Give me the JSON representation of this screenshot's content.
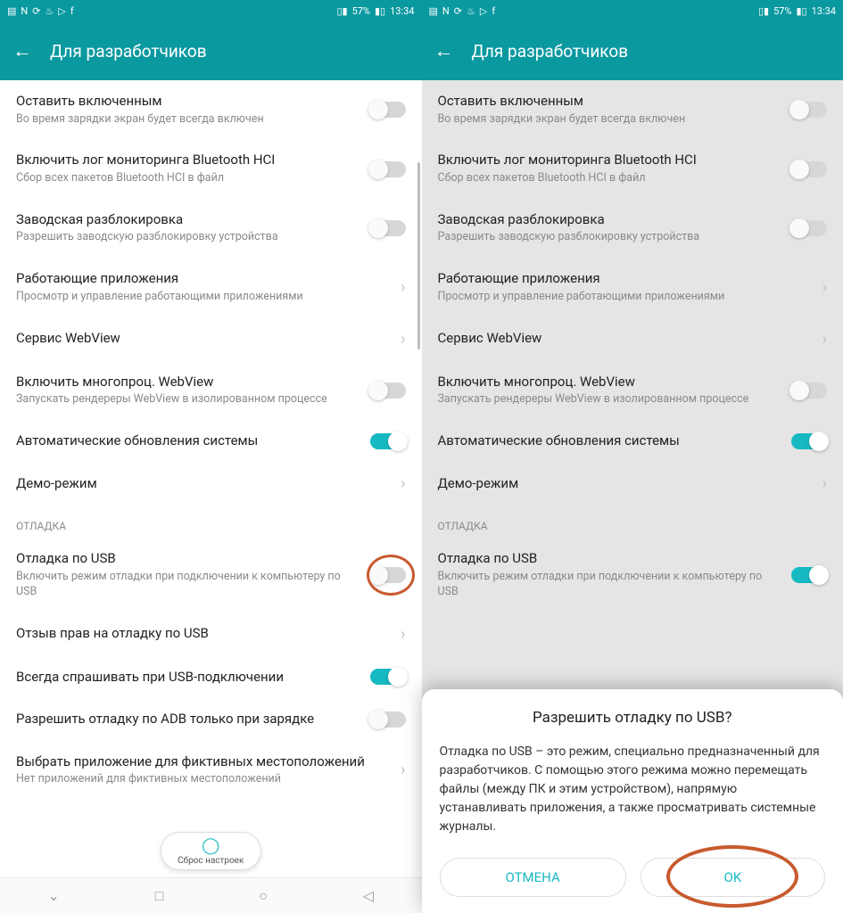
{
  "status_bar": {
    "icons_left": [
      "notif-icon",
      "nfc-icon",
      "sync-icon",
      "usb-icon",
      "play-icon",
      "facebook-icon"
    ],
    "vibrate_icon": "▮▯",
    "battery_pct": "57%",
    "battery_icon": "▮▯▯",
    "time": "13:34"
  },
  "app_bar": {
    "title": "Для разработчиков"
  },
  "sections": [
    {
      "header": null,
      "items": [
        {
          "id": "stay-awake",
          "title": "Оставить включенным",
          "sub": "Во время зарядки экран будет всегда включен",
          "ctrl": "toggle",
          "state": "off"
        },
        {
          "id": "bt-hci-log",
          "title": "Включить лог мониторинга Bluetooth HCI",
          "sub": "Сбор всех пакетов Bluetooth HCI в файл",
          "ctrl": "toggle",
          "state": "off"
        },
        {
          "id": "oem-unlock",
          "title": "Заводская разблокировка",
          "sub": "Разрешить заводскую разблокировку устройства",
          "ctrl": "toggle",
          "state": "off"
        },
        {
          "id": "running-apps",
          "title": "Работающие приложения",
          "sub": "Просмотр и управление работающими приложениями",
          "ctrl": "chevron"
        },
        {
          "id": "webview-service",
          "title": "Сервис WebView",
          "sub": null,
          "ctrl": "chevron"
        },
        {
          "id": "webview-multi",
          "title": "Включить многопроц. WebView",
          "sub": "Запускать рендереры WebView в изолированном процессе",
          "ctrl": "toggle",
          "state": "off"
        },
        {
          "id": "auto-update",
          "title": "Автоматические обновления системы",
          "sub": null,
          "ctrl": "toggle",
          "state": "on"
        },
        {
          "id": "demo-mode",
          "title": "Демо-режим",
          "sub": null,
          "ctrl": "chevron"
        }
      ]
    },
    {
      "header": "ОТЛАДКА",
      "items": [
        {
          "id": "usb-debug",
          "title": "Отладка по USB",
          "sub": "Включить режим отладки при подключении к компьютеру по USB",
          "ctrl": "toggle",
          "state": "off"
        },
        {
          "id": "revoke-usb",
          "title": "Отзыв прав на отладку по USB",
          "sub": null,
          "ctrl": "chevron"
        },
        {
          "id": "always-ask-usb",
          "title": "Всегда спрашивать при USB-подключении",
          "sub": null,
          "ctrl": "toggle",
          "state": "on"
        },
        {
          "id": "adb-charging",
          "title": "Разрешить отладку по ADB только при зарядке",
          "sub": null,
          "ctrl": "toggle",
          "state": "off"
        },
        {
          "id": "mock-location",
          "title": "Выбрать приложение для фиктивных местоположений",
          "sub": "Нет приложений для фиктивных местоположений",
          "ctrl": "chevron"
        }
      ]
    }
  ],
  "reset_pill": {
    "label": "Сброс настроек"
  },
  "dialog": {
    "title": "Разрешить отладку по USB?",
    "body": "Отладка по USB – это режим, специально предназначенный для разработчиков. С помощью этого режима можно перемещать файлы (между ПК и этим устройством), напрямую устанавливать приложения, а также просматривать системные журналы.",
    "cancel": "ОТМЕНА",
    "ok": "OK"
  },
  "right_usb_debug_state": "on"
}
